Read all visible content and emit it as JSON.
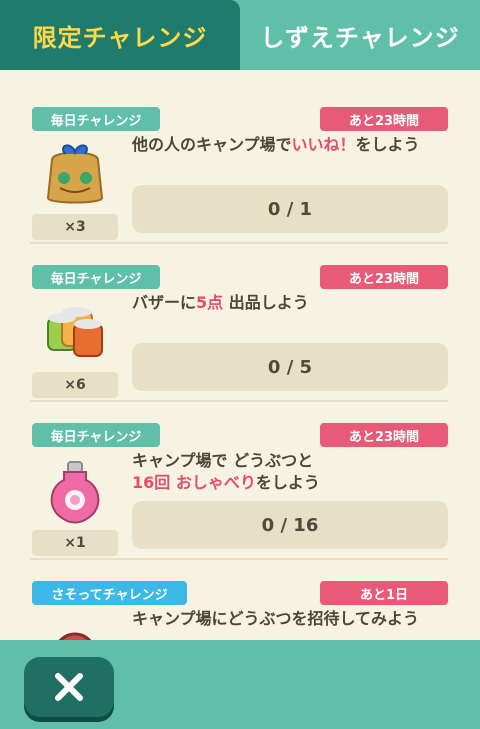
{
  "tabs": {
    "active": "限定チャレンジ",
    "inactive": "しずえチャレンジ"
  },
  "challenges": [
    {
      "type": "毎日チャレンジ",
      "time": "あと23時間",
      "qty": "×3",
      "desc_parts": [
        "他の人のキャンプ場で",
        "いいね！",
        "をしよう"
      ],
      "progress": "0 / 1",
      "icon": "gift-bag-icon"
    },
    {
      "type": "毎日チャレンジ",
      "time": "あと23時間",
      "qty": "×6",
      "desc_parts": [
        "バザーに",
        "5点",
        " 出品しよう"
      ],
      "progress": "0 / 5",
      "icon": "canned-food-icon"
    },
    {
      "type": "毎日チャレンジ",
      "time": "あと23時間",
      "qty": "×1",
      "desc_line1": "キャンプ場で どうぶつと",
      "desc_parts": [
        "16回",
        " ",
        "おしゃべり",
        "をしよう"
      ],
      "progress": "0 / 16",
      "icon": "potion-icon"
    },
    {
      "type": "さそってチャレンジ",
      "time": "あと1日",
      "desc": "キャンプ場にどうぶつを招待してみよう",
      "icon": "reward-item-icon"
    }
  ],
  "colors": {
    "primary_tab": "#1f7b6c",
    "accent_tab_text": "#ffd94a",
    "badge_green": "#5fbfa8",
    "badge_pink": "#e85a78",
    "badge_blue": "#3cb8e6",
    "highlight": "#e64a6c"
  },
  "close_icon": "close-icon"
}
